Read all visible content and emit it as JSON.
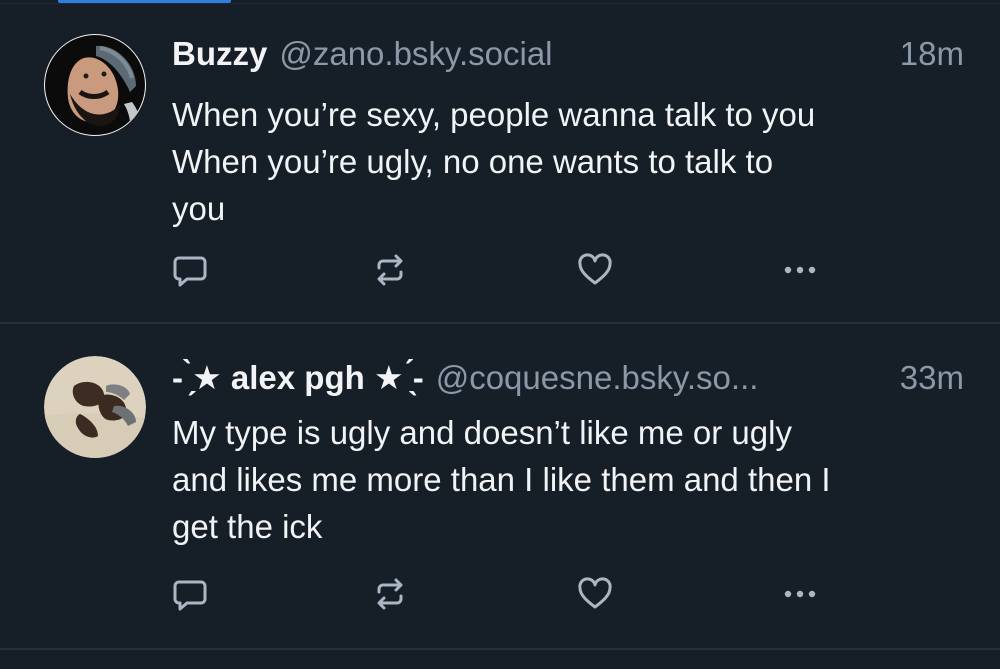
{
  "feed": {
    "posts": [
      {
        "display_name": "Buzzy",
        "handle": "@zano.bsky.social",
        "time": "18m",
        "text_lines": [
          "When you’re sexy, people wanna talk to you",
          "When you’re ugly, no one wants to talk to",
          "you"
        ],
        "avatar_icon": "bearded-man-avatar"
      },
      {
        "display_name": "- ̗̀★ alex pgh ★ ̖́-",
        "handle": "@coquesne.bsky.so...",
        "time": "33m",
        "text_lines": [
          "My type is ugly and doesn’t like me or ugly",
          "and likes me more than I like them and then I",
          "get the ick"
        ],
        "avatar_icon": "shoes-avatar"
      }
    ]
  },
  "icons": {
    "reply": "speech-bubble-icon",
    "repost": "repost-arrows-icon",
    "like": "heart-icon",
    "more": "ellipsis-icon"
  },
  "colors": {
    "background": "#161e27",
    "text": "#f1f3f5",
    "muted": "#8b98a8",
    "icon": "#aab6c4",
    "divider": "#26313d",
    "accent": "#2f7de1"
  }
}
